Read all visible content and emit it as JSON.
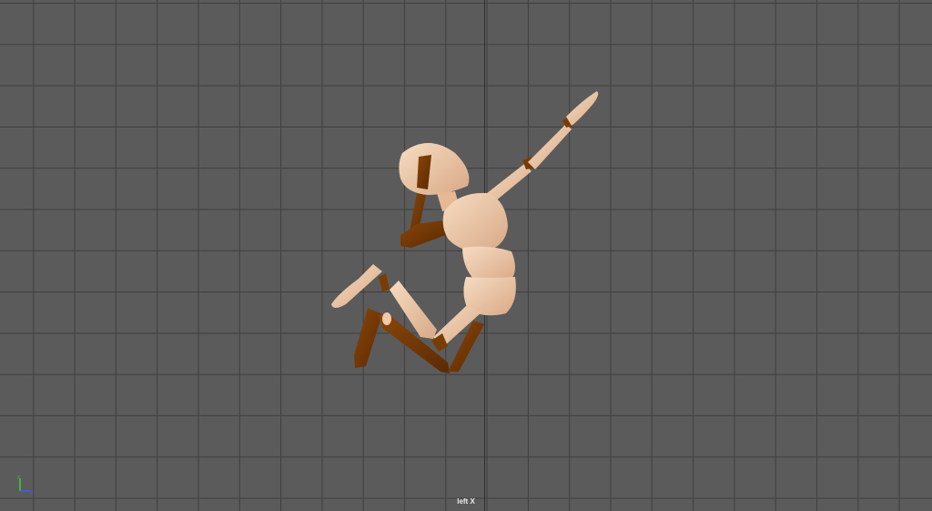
{
  "viewport": {
    "camera_label": "left X",
    "background_color": "#5b5b5b",
    "grid_color": "#3f3f3f",
    "grid": true
  },
  "model": {
    "skin_color": "#f0c9a8",
    "far_side_color": "#7a3c05"
  },
  "axis_gizmo": {
    "icon": "axis-gizmo-icon",
    "y_color": "#3cd23c",
    "z_color": "#3a5cff"
  }
}
